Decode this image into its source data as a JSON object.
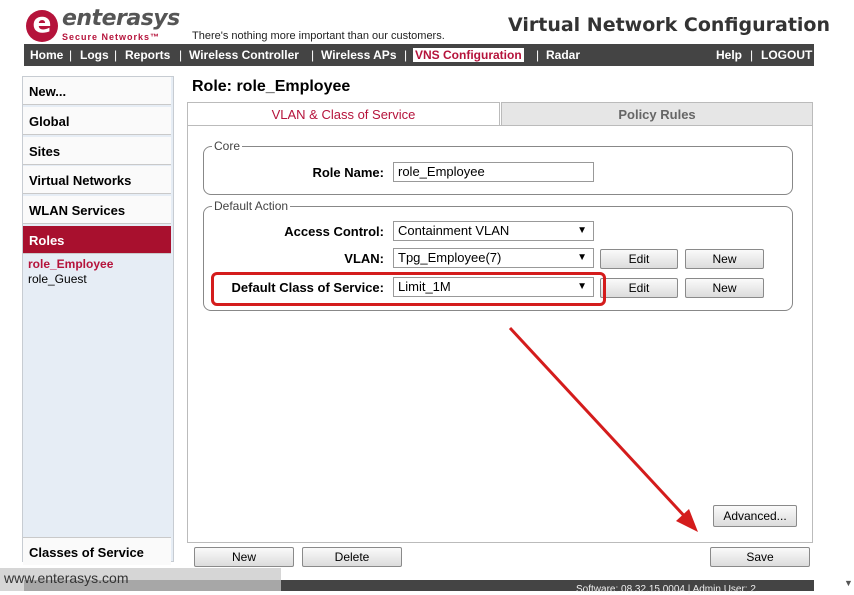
{
  "brand": {
    "logo_letter": "e",
    "name": "enterasys",
    "sub": "Secure Networks™",
    "tagline": "There's nothing more important than our customers."
  },
  "header": {
    "title": "Virtual Network Configuration"
  },
  "nav": {
    "home": "Home",
    "logs": "Logs",
    "reports": "Reports",
    "wireless_controller": "Wireless Controller",
    "wireless_aps": "Wireless APs",
    "vns": "VNS Configuration",
    "radar": "Radar",
    "help": "Help",
    "logout": "LOGOUT",
    "sep": "|"
  },
  "sidebar": {
    "items": [
      "New...",
      "Global",
      "Sites",
      "Virtual Networks",
      "WLAN Services",
      "Roles"
    ],
    "roles": [
      "role_Employee",
      "role_Guest"
    ],
    "bottom": "Classes of Service"
  },
  "main": {
    "title": "Role: role_Employee",
    "tabs": [
      "VLAN & Class of Service",
      "Policy Rules"
    ],
    "core": {
      "legend": "Core",
      "role_name_label": "Role Name:",
      "role_name_value": "role_Employee"
    },
    "default_action": {
      "legend": "Default Action",
      "access_label": "Access Control:",
      "access_value": "Containment VLAN",
      "vlan_label": "VLAN:",
      "vlan_value": "Tpg_Employee(7)",
      "cos_label": "Default Class of Service:",
      "cos_value": "Limit_1M",
      "edit": "Edit",
      "new": "New"
    },
    "advanced": "Advanced...",
    "new_button": "New",
    "delete_button": "Delete",
    "save_button": "Save"
  },
  "footer": {
    "text": "Software: 08.32.15.0004 | Admin User: 2"
  },
  "watermark": "www.enterasys.com",
  "colors": {
    "brand": "#b5133b",
    "nav": "#444444",
    "highlight": "#d41c1c"
  }
}
